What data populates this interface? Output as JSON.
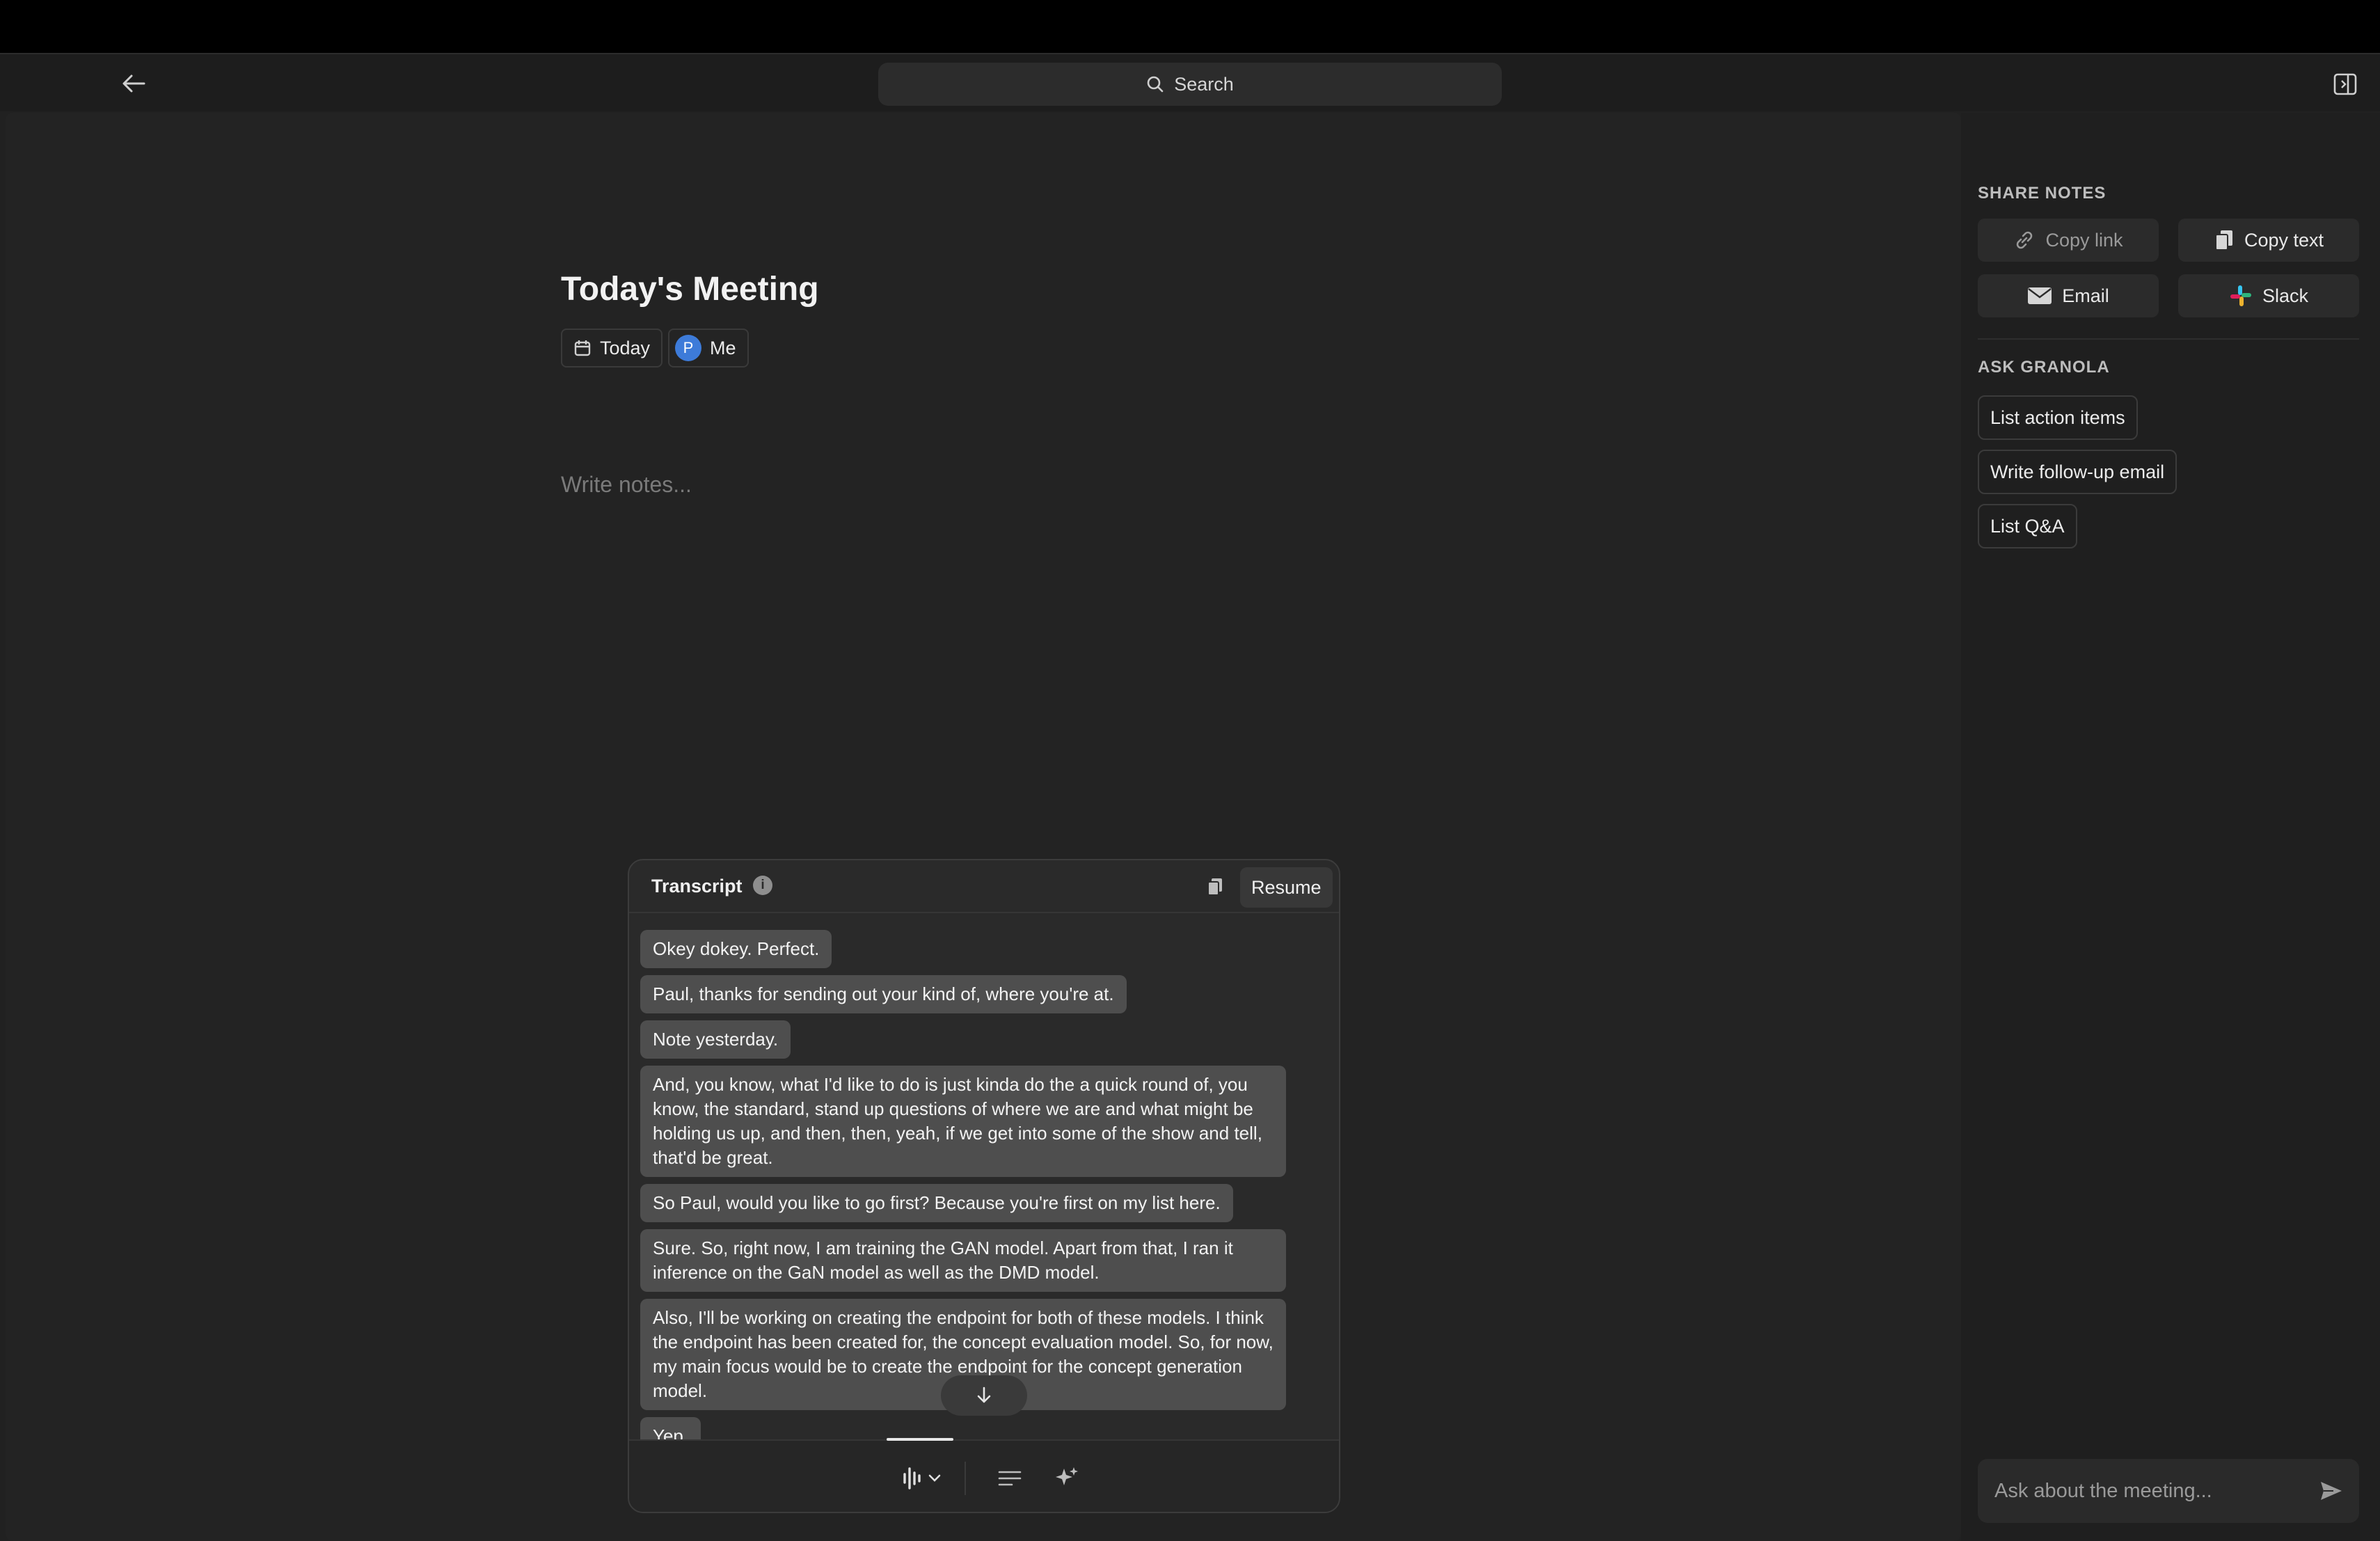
{
  "header": {
    "search_label": "Search"
  },
  "note": {
    "title": "Today's Meeting",
    "date_chip": "Today",
    "attendee_initial": "P",
    "attendee_chip": "Me",
    "notes_placeholder": "Write notes..."
  },
  "transcript": {
    "title": "Transcript",
    "resume_label": "Resume",
    "messages": [
      "Okey dokey. Perfect.",
      "Paul, thanks for sending out your kind of, where you're at.",
      "Note yesterday.",
      "And, you know, what I'd like to do is just kinda do the a quick round of, you know, the standard, stand up questions of where we are and what might be holding us up, and then, then, yeah, if we get into some of the show and tell, that'd be great.",
      "So Paul, would you like to go first? Because you're first on my list here.",
      "Sure. So, right now, I am training the GAN model. Apart from that, I ran it inference on the GaN model as well as the DMD model.",
      "Also, I'll be working on creating the endpoint for both of these models. I think the endpoint has been created for, the concept evaluation model. So, for now, my main focus would be to create the endpoint for the concept generation model.",
      "Yep."
    ]
  },
  "sidebar": {
    "share_label": "SHARE NOTES",
    "copy_link": "Copy link",
    "copy_text": "Copy text",
    "email": "Email",
    "slack": "Slack",
    "ask_label": "ASK GRANOLA",
    "ask_items": [
      "List action items",
      "Write follow-up email",
      "List Q&A"
    ],
    "ask_placeholder": "Ask about the meeting..."
  }
}
